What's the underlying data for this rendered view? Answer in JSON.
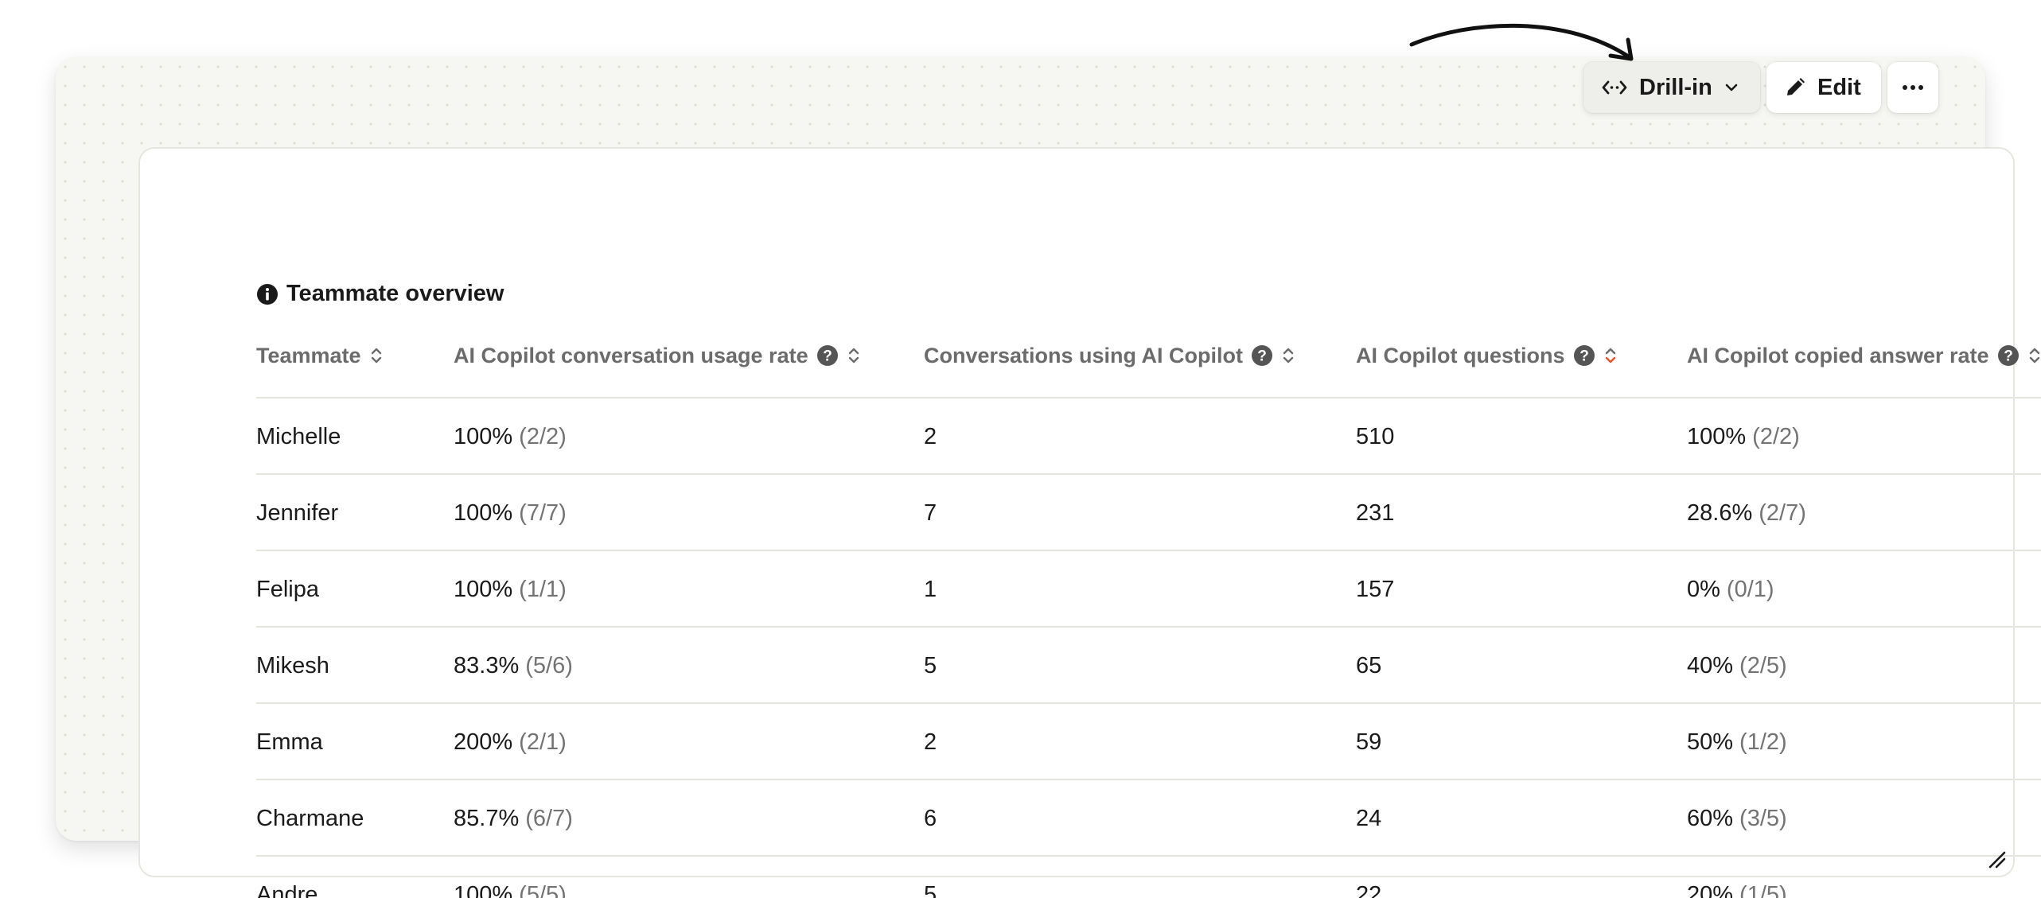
{
  "toolbar": {
    "drill_label": "Drill-in",
    "edit_label": "Edit"
  },
  "widget": {
    "title": "Teammate overview"
  },
  "columns": [
    {
      "label": "Teammate"
    },
    {
      "label": "AI Copilot conversation usage rate"
    },
    {
      "label": "Conversations using AI Copilot"
    },
    {
      "label": "AI Copilot questions",
      "sorted": true
    },
    {
      "label": "AI Copilot copied answer rate"
    }
  ],
  "rows": [
    {
      "name": "Michelle",
      "usage_pct": "100%",
      "usage_ratio": "(2/2)",
      "conversations": "2",
      "questions": "510",
      "copied_pct": "100%",
      "copied_ratio": "(2/2)"
    },
    {
      "name": "Jennifer",
      "usage_pct": "100%",
      "usage_ratio": "(7/7)",
      "conversations": "7",
      "questions": "231",
      "copied_pct": "28.6%",
      "copied_ratio": "(2/7)"
    },
    {
      "name": "Felipa",
      "usage_pct": "100%",
      "usage_ratio": "(1/1)",
      "conversations": "1",
      "questions": "157",
      "copied_pct": "0%",
      "copied_ratio": "(0/1)"
    },
    {
      "name": "Mikesh",
      "usage_pct": "83.3%",
      "usage_ratio": "(5/6)",
      "conversations": "5",
      "questions": "65",
      "copied_pct": "40%",
      "copied_ratio": "(2/5)"
    },
    {
      "name": "Emma",
      "usage_pct": "200%",
      "usage_ratio": "(2/1)",
      "conversations": "2",
      "questions": "59",
      "copied_pct": "50%",
      "copied_ratio": "(1/2)"
    },
    {
      "name": "Charmane",
      "usage_pct": "85.7%",
      "usage_ratio": "(6/7)",
      "conversations": "6",
      "questions": "24",
      "copied_pct": "60%",
      "copied_ratio": "(3/5)"
    },
    {
      "name": "Andre",
      "usage_pct": "100%",
      "usage_ratio": "(5/5)",
      "conversations": "5",
      "questions": "22",
      "copied_pct": "20%",
      "copied_ratio": "(1/5)"
    }
  ],
  "colors": {
    "text": "#1a1a1a",
    "muted": "#6b6b6b",
    "active_sort": "#e8542c",
    "border": "#e5e5e0"
  }
}
